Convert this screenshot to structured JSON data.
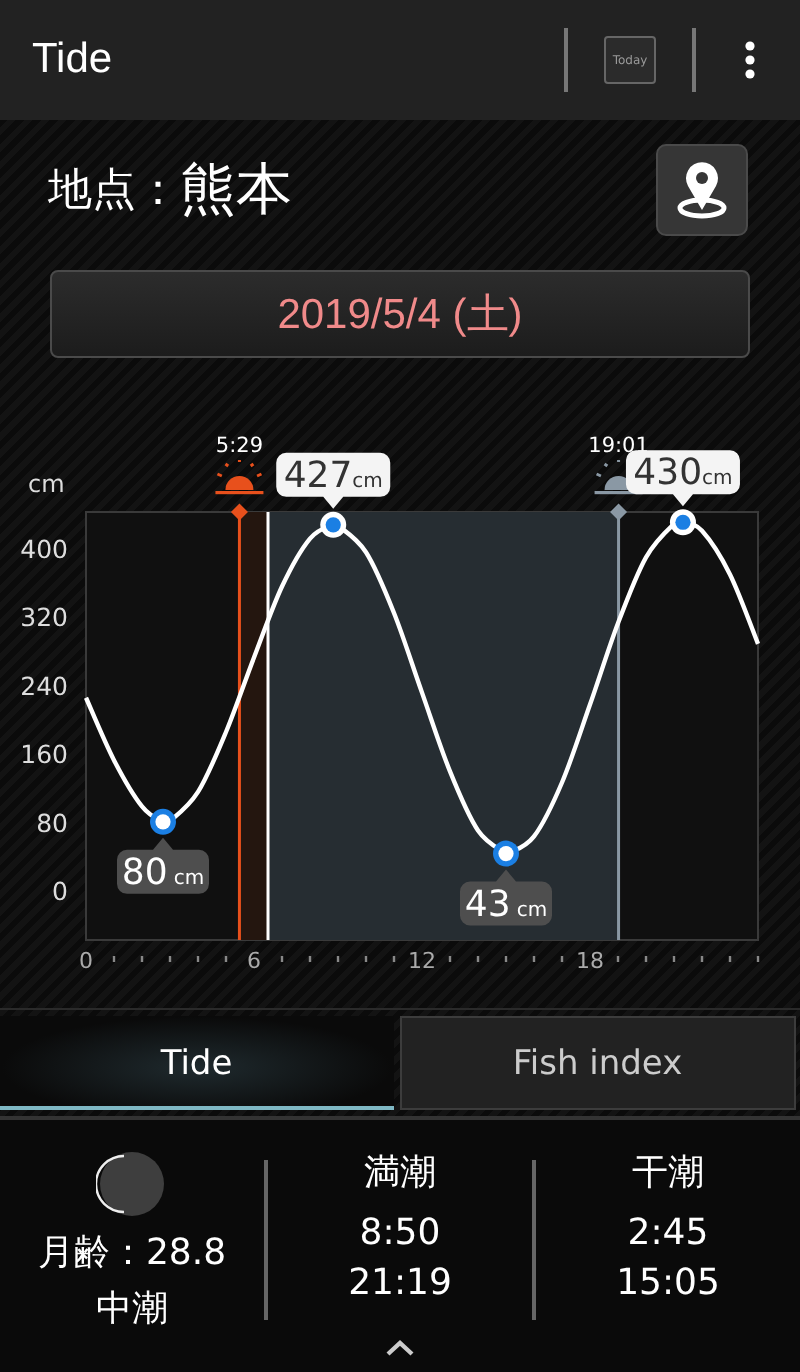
{
  "app_bar": {
    "title": "Tide",
    "today_label": "Today"
  },
  "location": {
    "label": "地点：",
    "name": "熊本"
  },
  "date": "2019/5/4 (土)",
  "chart": {
    "chart_data": {
      "type": "line",
      "ylabel": "cm",
      "xlim": [
        0,
        24
      ],
      "ylim": [
        -58,
        442
      ],
      "xticks": [
        0,
        6,
        12,
        18
      ],
      "yticks": [
        0,
        80,
        160,
        240,
        320,
        400
      ],
      "x": [
        0,
        1,
        2,
        2.75,
        3,
        4,
        5,
        6,
        7,
        8,
        8.83,
        9,
        10,
        11,
        12,
        13,
        14,
        15,
        15.08,
        16,
        17,
        18,
        19,
        20,
        21,
        21.32,
        22,
        23,
        24
      ],
      "series": [
        {
          "color": "#ffffff",
          "values": [
            225,
            152,
            98,
            80,
            81,
            115,
            185,
            272,
            355,
            411,
            427,
            426,
            395,
            324,
            231,
            139,
            70,
            43,
            43,
            63,
            126,
            217,
            312,
            389,
            428,
            430,
            420,
            369,
            288
          ]
        }
      ],
      "bands": [
        {
          "axis": "x",
          "from": 5.48,
          "to": 6.5,
          "color": "#24160f"
        },
        {
          "axis": "x",
          "from": 6.5,
          "to": 19.02,
          "color": "#262d32"
        }
      ],
      "ref_lines": [
        {
          "axis": "x",
          "value": 5.48,
          "label": "5:29",
          "color": "#e8501c"
        },
        {
          "axis": "x",
          "value": 19.02,
          "label": "19:01",
          "color": "#8a98a4"
        },
        {
          "axis": "x",
          "value": 6.5,
          "color": "#ffffff"
        }
      ]
    },
    "extremes": [
      {
        "value": "80",
        "unit": "cm"
      },
      {
        "value": "427",
        "unit": "cm"
      },
      {
        "value": "43",
        "unit": "cm"
      },
      {
        "value": "430",
        "unit": "cm"
      }
    ]
  },
  "tabs": [
    {
      "label": "Tide",
      "selected": true
    },
    {
      "label": "Fish index",
      "selected": false
    }
  ],
  "moon": {
    "age": "月齢：28.8",
    "tide_type": "中潮"
  },
  "high_tide": {
    "title": "満潮",
    "times": [
      "8:50",
      "21:19"
    ]
  },
  "low_tide": {
    "title": "干潮",
    "times": [
      "2:45",
      "15:05"
    ]
  }
}
